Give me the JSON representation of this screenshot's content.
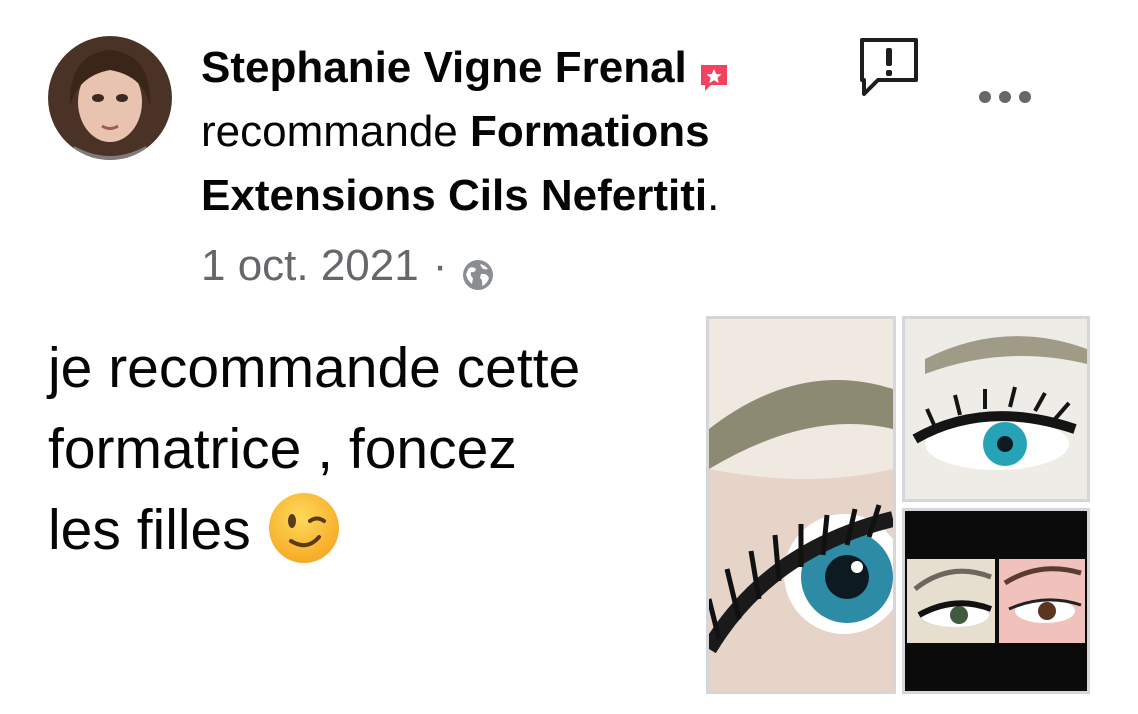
{
  "post": {
    "author": "Stephanie Vigne Frenal",
    "action_text": "recommande",
    "page_name_line1": "Formations",
    "page_name_line2": "Extensions Cils Nefertiti",
    "period": ".",
    "date": "1 oct. 2021",
    "separator": "·",
    "privacy_icon": "globe-icon",
    "badge_icon": "recommendation-badge-icon",
    "text_line1": "je recommande cette",
    "text_line2": "formatrice , foncez",
    "text_line3": "les filles",
    "emoji": "winking-face"
  },
  "actions": {
    "report_icon": "report-icon",
    "more_icon": "more-options-icon"
  },
  "colors": {
    "text": "#050505",
    "secondary_text": "#65676b",
    "badge": "#f3425f",
    "photo_border": "#d4d6da"
  }
}
